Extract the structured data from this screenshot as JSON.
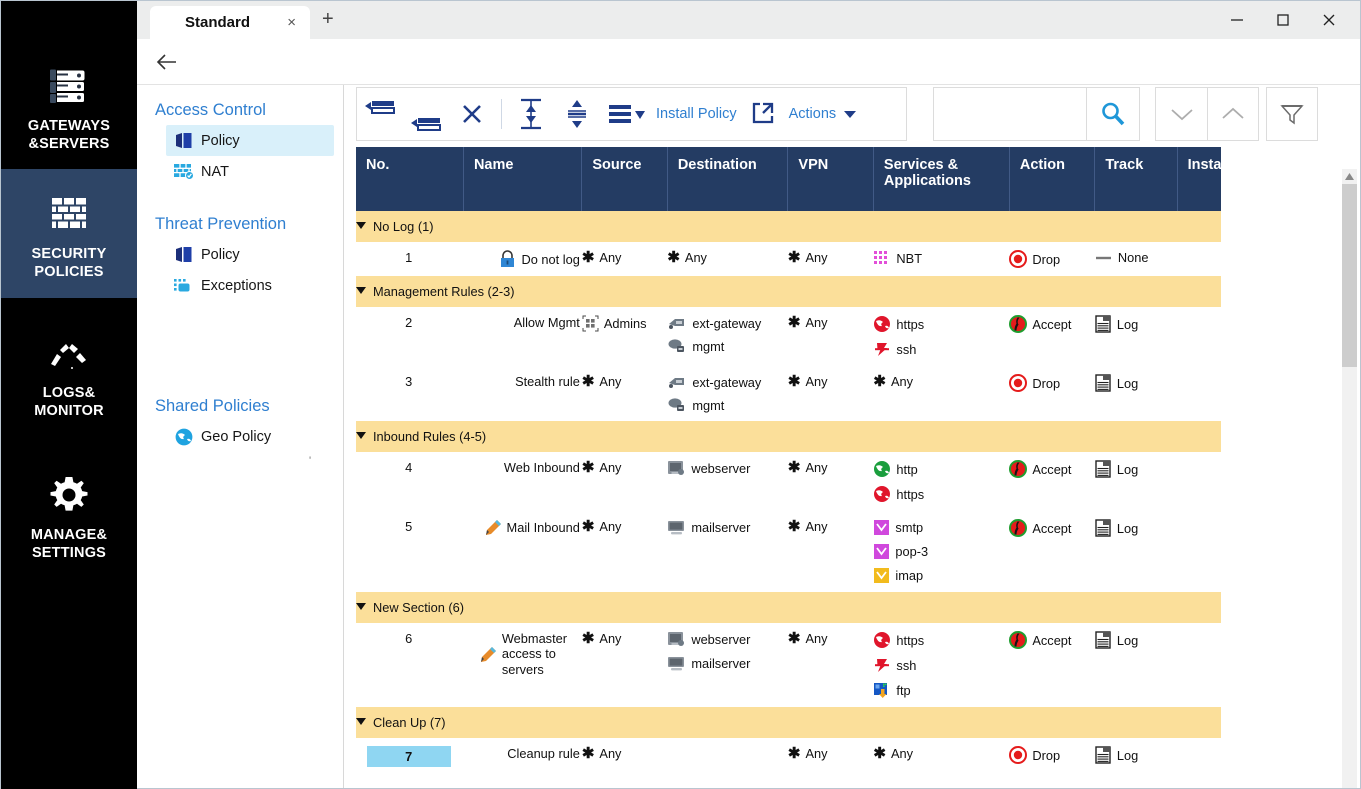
{
  "window": {
    "tab_title": "Standard",
    "tab_close": "×",
    "new_tab": "+",
    "minimize": "minimize-label",
    "maximize": "maximize-label",
    "close": "close-label"
  },
  "leftnav": [
    {
      "label": "GATEWAYS\n&SERVERS",
      "line1": "GATEWAYS",
      "line2": "&SERVERS",
      "icon": "servers-icon",
      "active": false
    },
    {
      "label": "SECURITY POLICIES",
      "line1": "SECURITY",
      "line2": "POLICIES",
      "icon": "firewall-brick-icon",
      "active": true
    },
    {
      "label": "LOGS& MONITOR",
      "line1": "LOGS&",
      "line2": "MONITOR",
      "icon": "gauge-icon",
      "active": false
    },
    {
      "label": "MANAGE& SETTINGS",
      "line1": "MANAGE&",
      "line2": "SETTINGS",
      "icon": "gear-icon",
      "active": false
    }
  ],
  "midnav": {
    "groups": [
      {
        "title": "Access Control",
        "items": [
          {
            "label": "Policy",
            "icon": "policy-book-icon",
            "selected": true
          },
          {
            "label": "NAT",
            "icon": "nat-brick-icon",
            "selected": false
          }
        ]
      },
      {
        "title": "Threat Prevention",
        "items": [
          {
            "label": "Policy",
            "icon": "policy-book-icon",
            "selected": false
          },
          {
            "label": "Exceptions",
            "icon": "exceptions-icon",
            "selected": false
          }
        ]
      },
      {
        "title": "Shared Policies",
        "items": [
          {
            "label": "Geo Policy",
            "icon": "globe-icon",
            "selected": false
          }
        ]
      }
    ]
  },
  "toolbar": {
    "buttons": [
      {
        "name": "add-rule-above",
        "icon": "add-rule-above-icon"
      },
      {
        "name": "add-rule-below",
        "icon": "add-rule-below-icon"
      },
      {
        "name": "delete-rule",
        "icon": "x-delete-icon"
      },
      {
        "name": "move-to-bottom",
        "icon": "collapse-vertical-icon"
      },
      {
        "name": "move-to-top",
        "icon": "expand-vertical-icon"
      },
      {
        "name": "layout-options",
        "icon": "list-lines-icon"
      }
    ],
    "install_policy": "Install Policy",
    "actions": "Actions",
    "search_value": "",
    "search_placeholder": "",
    "search_icon": "search-icon",
    "down_icon": "chevron-down-icon",
    "up_icon": "chevron-up-icon",
    "filter_icon": "funnel-filter-icon"
  },
  "table": {
    "columns": [
      "No.",
      "Name",
      "Source",
      "Destination",
      "VPN",
      "Services &\nApplications",
      "Action",
      "Track",
      "Insta"
    ],
    "columns_display": [
      "No.",
      "Name",
      "Source",
      "Destination",
      "VPN",
      "Services & Applications",
      "Action",
      "Track",
      "Insta"
    ],
    "col_services_line1": "Services &",
    "col_services_line2": "Applications",
    "sections": [
      {
        "title": "No Log (1)",
        "rows": [
          {
            "no": "1",
            "selected": false,
            "name": [
              {
                "label": "Do not log",
                "icon": "lock-icon"
              }
            ],
            "source": [
              {
                "label": "Any",
                "icon": "asterisk-any-icon"
              }
            ],
            "destination": [
              {
                "label": "Any",
                "icon": "asterisk-any-icon"
              }
            ],
            "vpn": [
              {
                "label": "Any",
                "icon": "asterisk-any-icon"
              }
            ],
            "services": [
              {
                "label": "NBT",
                "icon": "nbt-service-icon"
              }
            ],
            "action": [
              {
                "label": "Drop",
                "icon": "drop-icon"
              }
            ],
            "track": [
              {
                "label": "None",
                "icon": "none-dash-icon"
              }
            ]
          }
        ]
      },
      {
        "title": "Management Rules (2-3)",
        "rows": [
          {
            "no": "2",
            "selected": false,
            "name": [
              {
                "label": "Allow Mgmt",
                "icon": ""
              }
            ],
            "source": [
              {
                "label": "Admins",
                "icon": "admins-group-icon"
              }
            ],
            "destination": [
              {
                "label": "ext-gateway",
                "icon": "gateway-icon"
              },
              {
                "label": "mgmt",
                "icon": "mgmt-server-icon"
              }
            ],
            "vpn": [
              {
                "label": "Any",
                "icon": "asterisk-any-icon"
              }
            ],
            "services": [
              {
                "label": "https",
                "icon": "https-globe-icon"
              },
              {
                "label": "ssh",
                "icon": "ssh-icon"
              }
            ],
            "action": [
              {
                "label": "Accept",
                "icon": "accept-icon"
              }
            ],
            "track": [
              {
                "label": "Log",
                "icon": "log-icon"
              }
            ]
          },
          {
            "no": "3",
            "selected": false,
            "name": [
              {
                "label": "Stealth rule",
                "icon": ""
              }
            ],
            "source": [
              {
                "label": "Any",
                "icon": "asterisk-any-icon"
              }
            ],
            "destination": [
              {
                "label": "ext-gateway",
                "icon": "gateway-icon"
              },
              {
                "label": "mgmt",
                "icon": "mgmt-server-icon"
              }
            ],
            "vpn": [
              {
                "label": "Any",
                "icon": "asterisk-any-icon"
              }
            ],
            "services": [
              {
                "label": "Any",
                "icon": "asterisk-any-icon"
              }
            ],
            "action": [
              {
                "label": "Drop",
                "icon": "drop-icon"
              }
            ],
            "track": [
              {
                "label": "Log",
                "icon": "log-icon"
              }
            ]
          }
        ]
      },
      {
        "title": "Inbound Rules (4-5)",
        "rows": [
          {
            "no": "4",
            "selected": false,
            "name": [
              {
                "label": "Web Inbound",
                "icon": ""
              }
            ],
            "source": [
              {
                "label": "Any",
                "icon": "asterisk-any-icon"
              }
            ],
            "destination": [
              {
                "label": "webserver",
                "icon": "webserver-icon"
              }
            ],
            "vpn": [
              {
                "label": "Any",
                "icon": "asterisk-any-icon"
              }
            ],
            "services": [
              {
                "label": "http",
                "icon": "http-globe-icon"
              },
              {
                "label": "https",
                "icon": "https-globe-icon"
              }
            ],
            "action": [
              {
                "label": "Accept",
                "icon": "accept-icon"
              }
            ],
            "track": [
              {
                "label": "Log",
                "icon": "log-icon"
              }
            ]
          },
          {
            "no": "5",
            "selected": false,
            "name": [
              {
                "label": "Mail Inbound",
                "icon": "pencil-icon"
              }
            ],
            "source": [
              {
                "label": "Any",
                "icon": "asterisk-any-icon"
              }
            ],
            "destination": [
              {
                "label": "mailserver",
                "icon": "mailserver-icon"
              }
            ],
            "vpn": [
              {
                "label": "Any",
                "icon": "asterisk-any-icon"
              }
            ],
            "services": [
              {
                "label": "smtp",
                "icon": "mail-service-icon"
              },
              {
                "label": "pop-3",
                "icon": "mail-service-icon"
              },
              {
                "label": "imap",
                "icon": "imap-service-icon"
              }
            ],
            "action": [
              {
                "label": "Accept",
                "icon": "accept-icon"
              }
            ],
            "track": [
              {
                "label": "Log",
                "icon": "log-icon"
              }
            ]
          }
        ]
      },
      {
        "title": "New Section (6)",
        "rows": [
          {
            "no": "6",
            "selected": false,
            "name": [
              {
                "label": "Webmaster access to servers",
                "icon": "pencil-icon",
                "multiline": true
              }
            ],
            "source": [
              {
                "label": "Any",
                "icon": "asterisk-any-icon"
              }
            ],
            "destination": [
              {
                "label": "webserver",
                "icon": "webserver-icon"
              },
              {
                "label": "mailserver",
                "icon": "mailserver-icon"
              }
            ],
            "vpn": [
              {
                "label": "Any",
                "icon": "asterisk-any-icon"
              }
            ],
            "services": [
              {
                "label": "https",
                "icon": "https-globe-icon"
              },
              {
                "label": "ssh",
                "icon": "ssh-icon"
              },
              {
                "label": "ftp",
                "icon": "ftp-icon"
              }
            ],
            "action": [
              {
                "label": "Accept",
                "icon": "accept-icon"
              }
            ],
            "track": [
              {
                "label": "Log",
                "icon": "log-icon"
              }
            ]
          }
        ]
      },
      {
        "title": "Clean Up (7)",
        "rows": [
          {
            "no": "7",
            "selected": true,
            "name": [
              {
                "label": "Cleanup rule",
                "icon": ""
              }
            ],
            "source": [
              {
                "label": "Any",
                "icon": "asterisk-any-icon"
              }
            ],
            "destination": [],
            "vpn": [
              {
                "label": "Any",
                "icon": "asterisk-any-icon"
              }
            ],
            "services": [
              {
                "label": "Any",
                "icon": "asterisk-any-icon"
              }
            ],
            "action": [
              {
                "label": "Drop",
                "icon": "drop-icon"
              }
            ],
            "track": [
              {
                "label": "Log",
                "icon": "log-icon"
              }
            ]
          }
        ]
      }
    ]
  },
  "colors": {
    "nav_bg": "#000000",
    "nav_active": "#2e4566",
    "accent_blue": "#2f7fd0",
    "header_navy": "#243c63",
    "section_yellow": "#fbdf9a",
    "selected_cyan": "#8fd6f2",
    "drop_red": "#e02020",
    "accept_green": "#1f9d2f"
  }
}
